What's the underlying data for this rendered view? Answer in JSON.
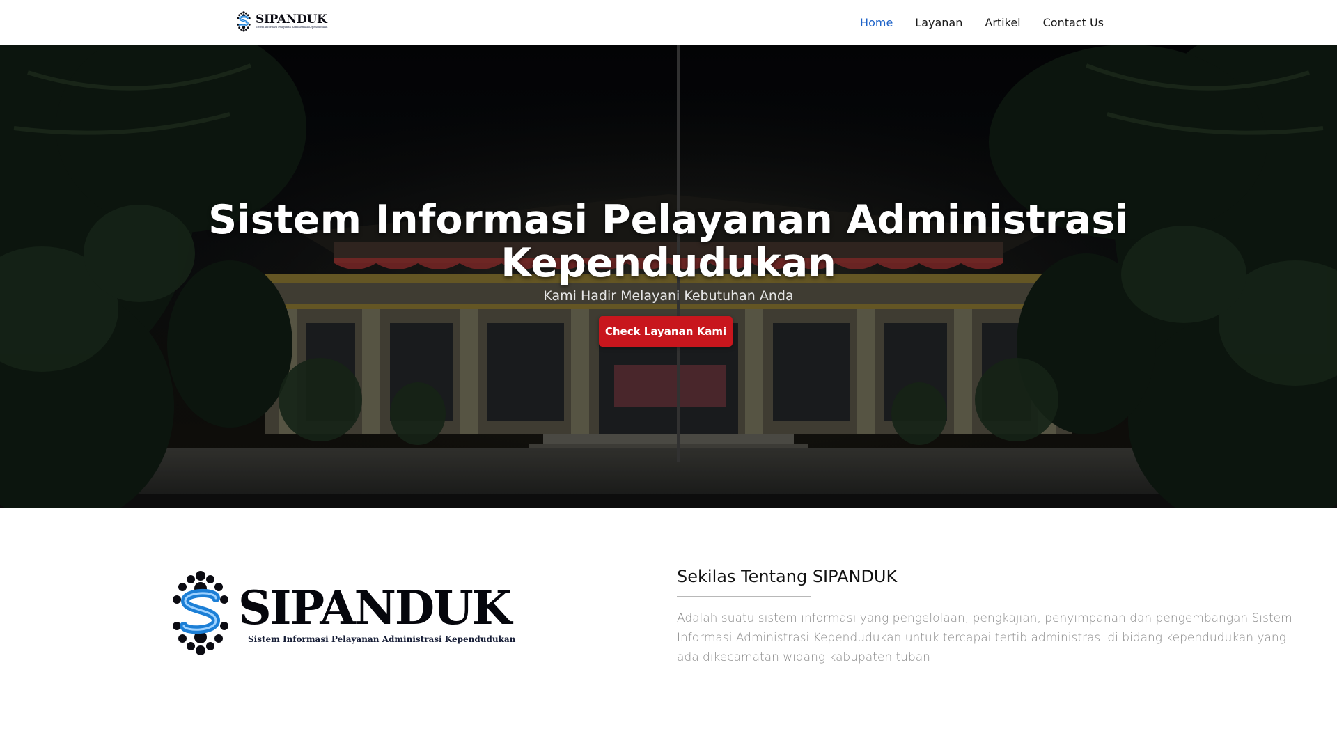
{
  "nav": {
    "brand": "SIPANDUK",
    "brand_tagline": "Sistem Informasi Pelayanan Administrasi Kependudukan",
    "items": [
      {
        "label": "Home",
        "active": true
      },
      {
        "label": "Layanan",
        "active": false
      },
      {
        "label": "Artikel",
        "active": false
      },
      {
        "label": "Contact Us",
        "active": false
      }
    ],
    "active_color": "#1e63c8"
  },
  "hero": {
    "title_line1": "Sistem Informasi Pelayanan Administrasi",
    "title_line2": "Kependudukan",
    "subtitle": "Kami Hadir Melayani Kebutuhan Anda",
    "button_label": "Check Layanan Kami",
    "button_color": "#c8161d"
  },
  "about": {
    "logo_word": "SIPANDUK",
    "logo_tagline": "Sistem Informasi Pelayanan Administrasi Kependudukan",
    "heading": "Sekilas Tentang SIPANDUK",
    "body": "Adalah suatu sistem informasi yang pengelolaan, pengkajian, penyimpanan dan pengembangan Sistem Informasi Administrasi Kependudukan untuk tercapai tertib administrasi di bidang kependudukan yang ada dikecamatan widang kabupaten tuban."
  },
  "icons": {
    "logo_mark": "sipanduk-logo-icon"
  }
}
